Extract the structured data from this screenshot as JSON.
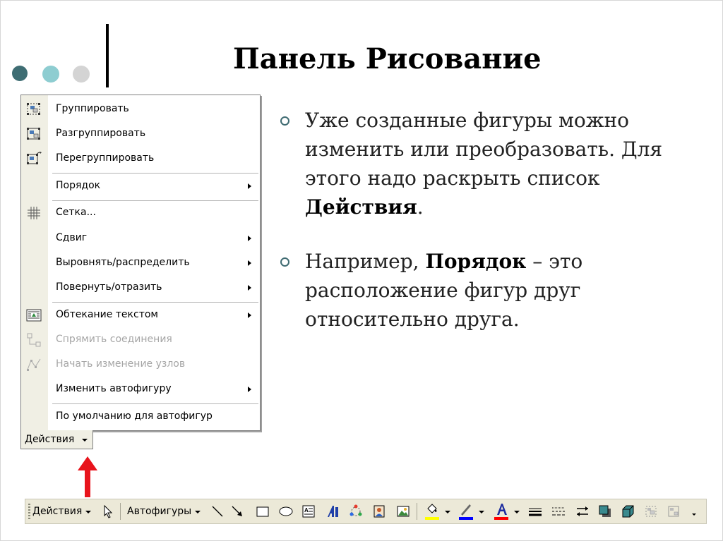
{
  "slide": {
    "title": "Панель Рисование",
    "dot_colors": [
      "#3e6d73",
      "#8ecdd1",
      "#d4d4d4"
    ]
  },
  "menu": {
    "items": [
      {
        "label": "Группировать",
        "icon": "group-icon",
        "enabled": true,
        "submenu": false
      },
      {
        "label": "Разгруппировать",
        "icon": "ungroup-icon",
        "enabled": true,
        "submenu": false
      },
      {
        "label": "Перегруппировать",
        "icon": "regroup-icon",
        "enabled": true,
        "submenu": false
      },
      {
        "label": "Порядок",
        "icon": "",
        "enabled": true,
        "submenu": true
      },
      {
        "label": "Сетка...",
        "icon": "grid-icon",
        "enabled": true,
        "submenu": false
      },
      {
        "label": "Сдвиг",
        "icon": "",
        "enabled": true,
        "submenu": true
      },
      {
        "label": "Выровнять/распределить",
        "icon": "",
        "enabled": true,
        "submenu": true
      },
      {
        "label": "Повернуть/отразить",
        "icon": "",
        "enabled": true,
        "submenu": true
      },
      {
        "label": "Обтекание текстом",
        "icon": "text-wrap-icon",
        "enabled": true,
        "submenu": true
      },
      {
        "label": "Спрямить соединения",
        "icon": "reroute-connectors-icon",
        "enabled": false,
        "submenu": false
      },
      {
        "label": "Начать изменение узлов",
        "icon": "edit-points-icon",
        "enabled": false,
        "submenu": false
      },
      {
        "label": "Изменить автофигуру",
        "icon": "",
        "enabled": true,
        "submenu": true
      },
      {
        "label": "По умолчанию для автофигур",
        "icon": "",
        "enabled": true,
        "submenu": false
      }
    ],
    "button_label": "Действия"
  },
  "content": {
    "bullet1": {
      "before": "Уже созданные фигуры можно изменить или преобразовать. Для этого надо раскрыть список ",
      "bold": "Действия",
      "after": "."
    },
    "bullet2": {
      "before": "Например, ",
      "bold": "Порядок",
      "after": " – это расположение фигур друг относительно друга."
    }
  },
  "toolbar": {
    "actions_label": "Действия",
    "autoshapes_label": "Автофигуры",
    "fill_color": "#ffff00",
    "line_color": "#0000ff",
    "font_color": "#ff0000",
    "icons": [
      "select-pointer-icon",
      "line-icon",
      "arrow-icon",
      "rectangle-icon",
      "oval-icon",
      "textbox-icon",
      "wordart-icon",
      "diagram-icon",
      "clipart-icon",
      "picture-icon",
      "fill-color-icon",
      "line-color-icon",
      "font-color-icon",
      "line-style-icon",
      "dash-style-icon",
      "arrow-style-icon",
      "shadow-icon",
      "3d-icon",
      "group-icon",
      "ungroup-icon"
    ]
  }
}
